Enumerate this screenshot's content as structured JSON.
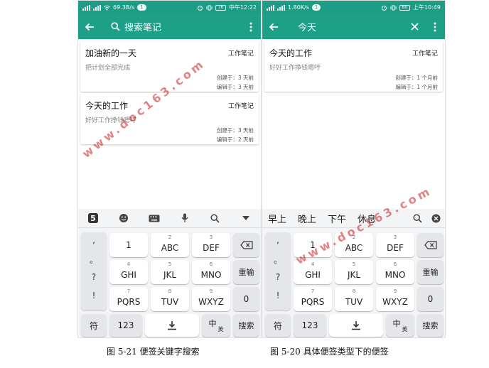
{
  "left": {
    "status": {
      "left": "69.3B/s",
      "badge": "1",
      "battery": "76",
      "time": "中午12:22"
    },
    "toolbar": {
      "title": "搜索笔记"
    },
    "notes": [
      {
        "title": "加油新的一天",
        "category": "工作笔记",
        "body": "把计划全部完成",
        "created": "创建于：3 天前",
        "edited": "编辑于：3 天前"
      },
      {
        "title": "今天的工作",
        "category": "工作笔记",
        "body": "好好工作挣钱嗯哼",
        "created": "创建于：3 天前",
        "edited": "编辑于：2 天前"
      }
    ],
    "caption": "图 5-21 便签关键字搜索"
  },
  "right": {
    "status": {
      "left": "1.80K/s",
      "badge": "1",
      "battery": "80",
      "time": "上午10:49"
    },
    "toolbar": {
      "title": "今天"
    },
    "notes": [
      {
        "title": "今天的工作",
        "category": "工作笔记",
        "body": "好好工作挣钱嗯哼",
        "created": "创建于：1 个月前",
        "edited": "编辑于：1 个月前"
      }
    ],
    "candidates": [
      "早上",
      "晚上",
      "下午",
      "休息"
    ],
    "caption": "图 5-20 具体便签类型下的便签"
  },
  "keyboard": {
    "side_keys": [
      ",",
      "。",
      "?",
      "!"
    ],
    "rows": [
      [
        {
          "num": "",
          "label": "1"
        },
        {
          "num": "2",
          "label": "ABC"
        },
        {
          "num": "3",
          "label": "DEF"
        }
      ],
      [
        {
          "num": "4",
          "label": "GHI"
        },
        {
          "num": "5",
          "label": "JKL"
        },
        {
          "num": "6",
          "label": "MNO"
        }
      ],
      [
        {
          "num": "7",
          "label": "PQRS"
        },
        {
          "num": "8",
          "label": "TUV"
        },
        {
          "num": "9",
          "label": "WXYZ"
        }
      ]
    ],
    "reenter": "重输",
    "zero": "0",
    "symbol": "符",
    "digits": "123",
    "lang_main": "中",
    "lang_sub": "英",
    "search": "搜索"
  },
  "watermark": "www.doc163.com"
}
